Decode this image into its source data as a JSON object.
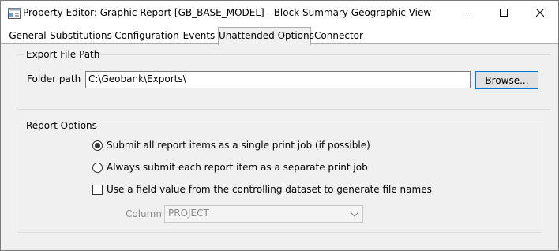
{
  "window": {
    "title": "Property Editor: Graphic Report [GB_BASE_MODEL] - Block Summary Geographic View"
  },
  "tabs": [
    {
      "label": "General"
    },
    {
      "label": "Substitutions"
    },
    {
      "label": "Configuration"
    },
    {
      "label": "Events"
    },
    {
      "label": "Unattended Options"
    },
    {
      "label": "Connector"
    }
  ],
  "active_tab": "Unattended Options",
  "export": {
    "group_label": "Export File Path",
    "folder_label": "Folder path",
    "folder_value": "C:\\Geobank\\Exports\\",
    "browse_label": "Browse..."
  },
  "report_options": {
    "group_label": "Report Options",
    "radio_single": "Submit all report items as a single print job (if possible)",
    "radio_separate": "Always submit each report item as a separate print job",
    "selected": "single",
    "checkbox_label": "Use a field value from the controlling dataset to generate file names",
    "checkbox_checked": false,
    "column_label": "Column",
    "column_value": "PROJECT"
  },
  "icons": {
    "app": "graphic-report-icon",
    "minimize": "minimize-icon",
    "maximize": "maximize-icon",
    "close": "close-icon",
    "dropdown": "chevron-down-icon"
  }
}
